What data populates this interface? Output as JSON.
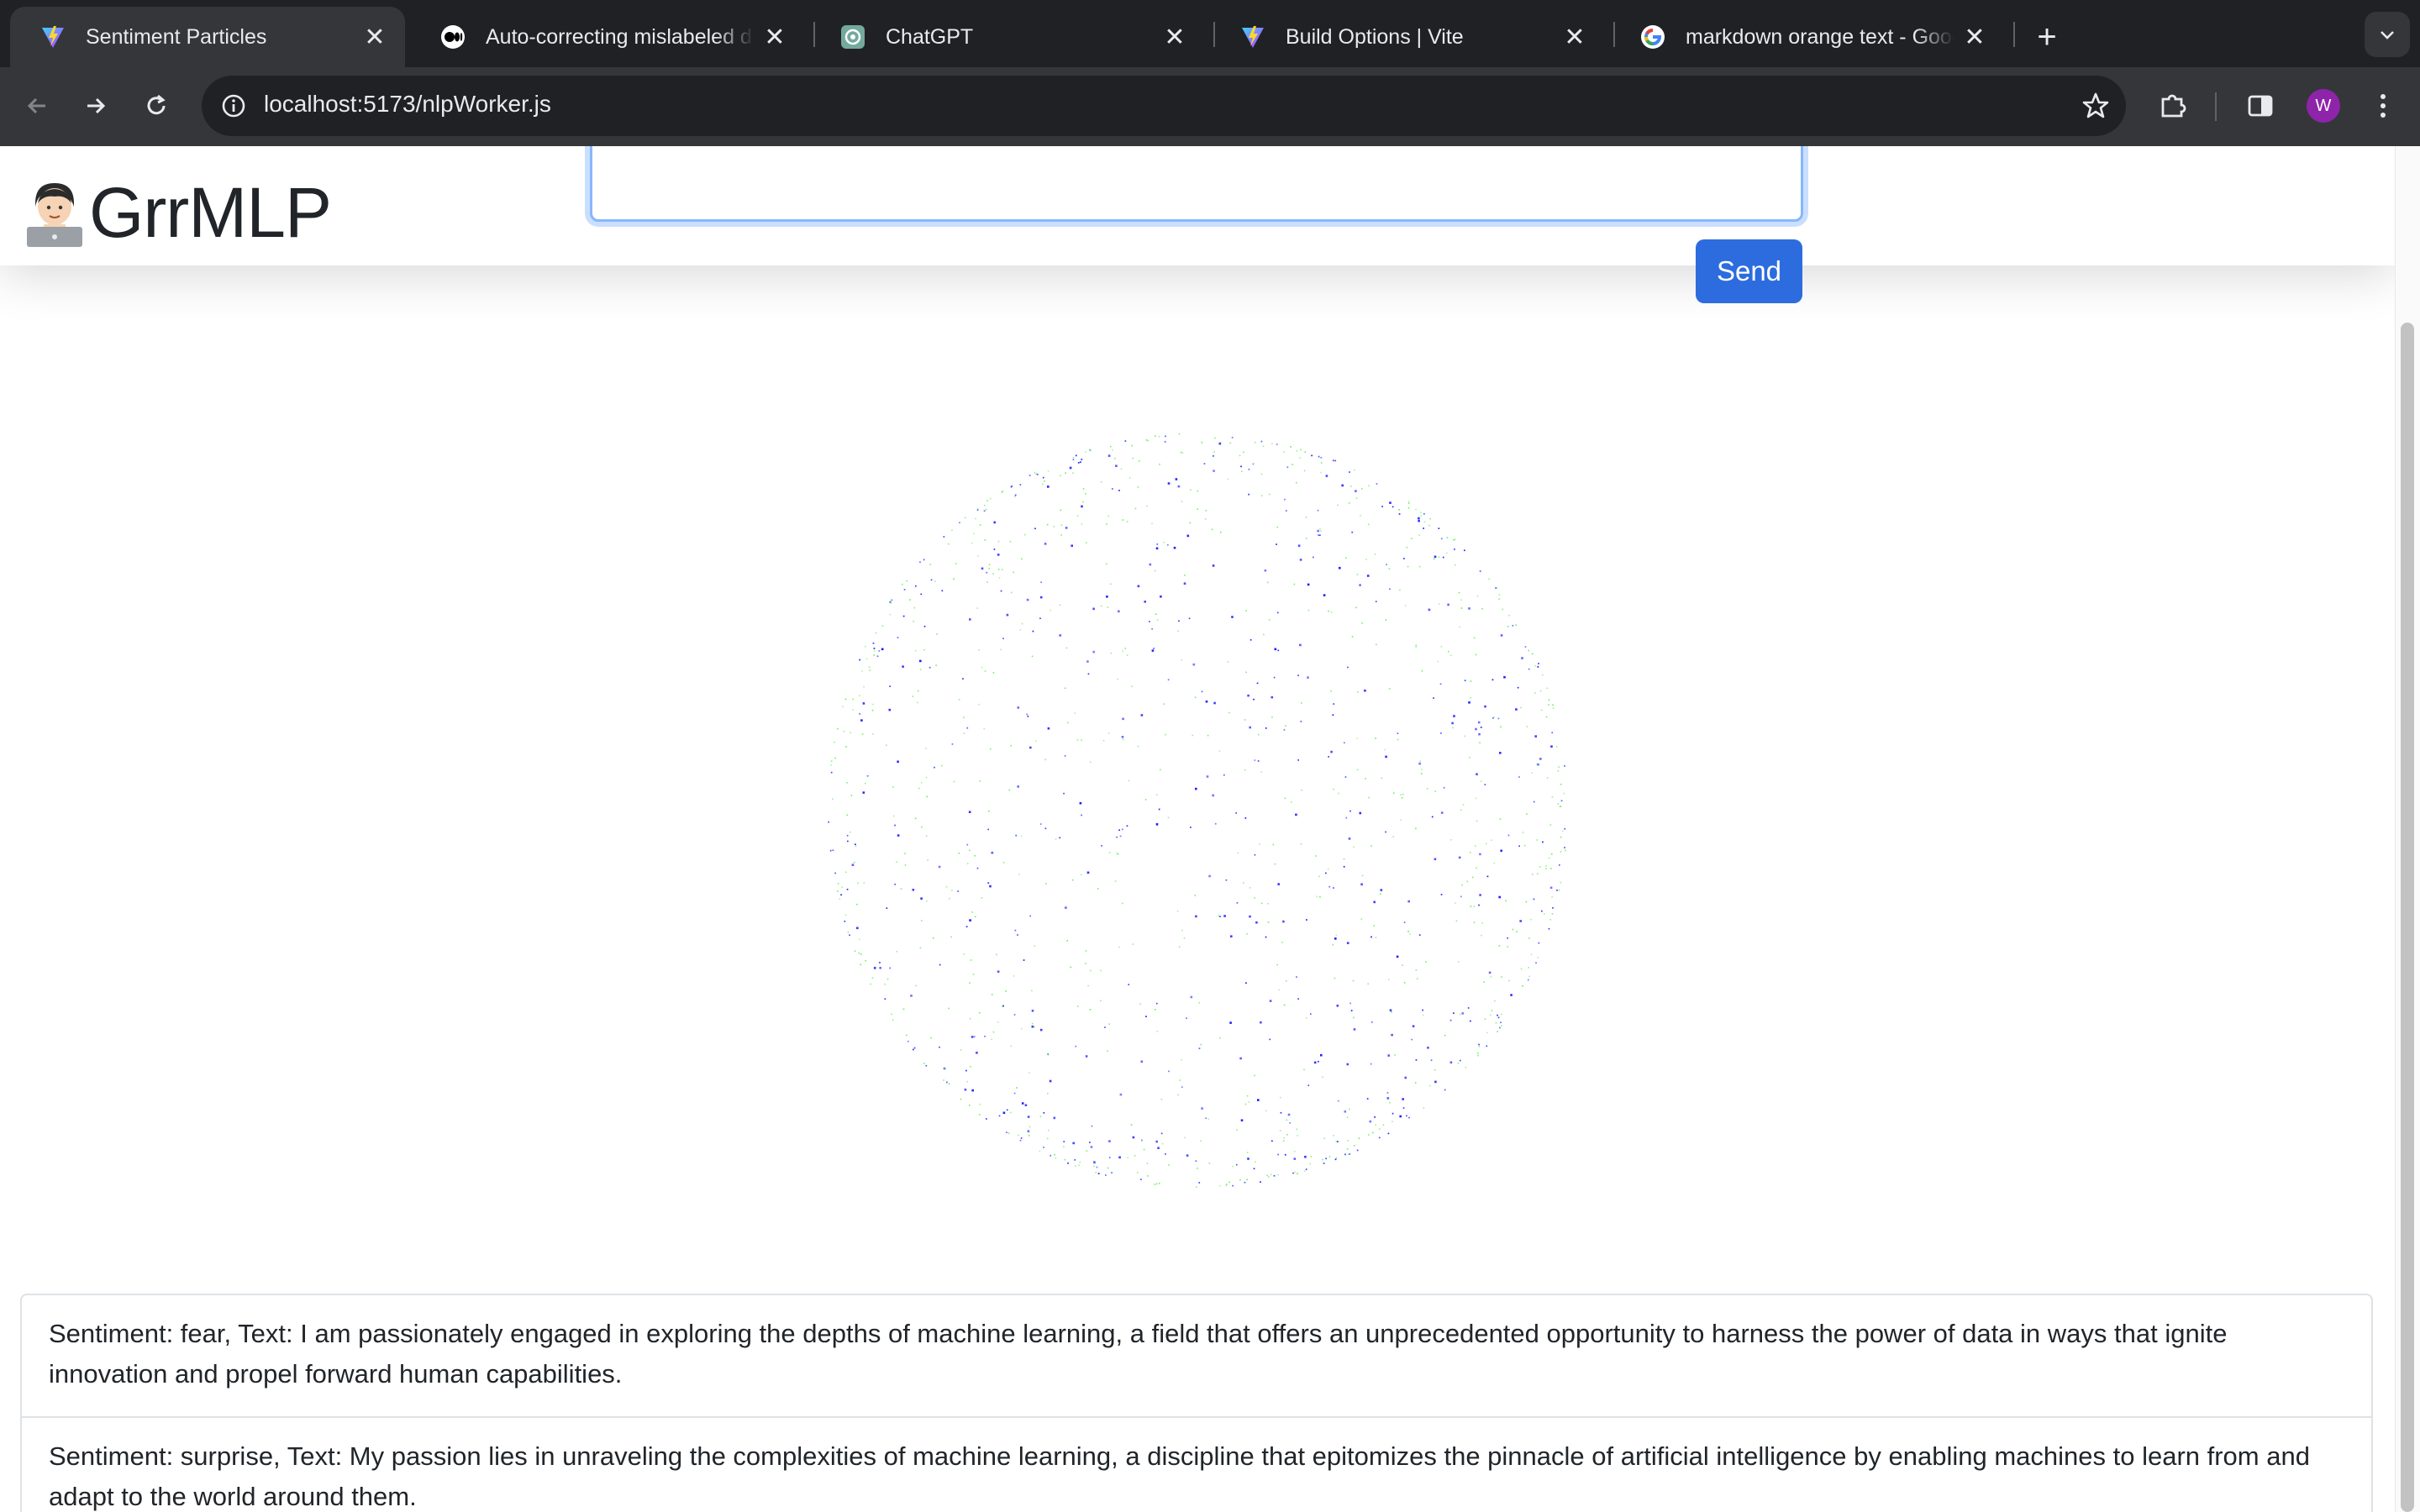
{
  "browser": {
    "tabs": [
      {
        "title": "Sentiment Particles",
        "icon": "vite-icon",
        "active": true
      },
      {
        "title": "Auto-correcting mislabeled d",
        "icon": "medium-icon",
        "active": false
      },
      {
        "title": "ChatGPT",
        "icon": "chatgpt-icon",
        "active": false
      },
      {
        "title": "Build Options | Vite",
        "icon": "vite-icon",
        "active": false
      },
      {
        "title": "markdown orange text - Goog",
        "icon": "google-icon",
        "active": false
      }
    ],
    "url": "localhost:5173/nlpWorker.js",
    "profile_initial": "W"
  },
  "app": {
    "brand_emoji": "technologist-emoji",
    "brand_name": "GrrMLP",
    "input_value": "",
    "send_label": "Send"
  },
  "particles": {
    "colors": {
      "blue": "#1a1aff",
      "green": "#66ee55"
    },
    "shape": "sphere"
  },
  "results": [
    {
      "text": "Sentiment: fear, Text: I am passionately engaged in exploring the depths of machine learning, a field that offers an unprecedented opportunity to harness the power of data in ways that ignite innovation and propel forward human capabilities."
    },
    {
      "text": "Sentiment: surprise, Text: My passion lies in unraveling the complexities of machine learning, a discipline that epitomizes the pinnacle of artificial intelligence by enabling machines to learn from and adapt to the world around them."
    }
  ],
  "colors": {
    "accent": "#2d6cdf",
    "chrome_dark": "#202124",
    "chrome_toolbar": "#35363a"
  }
}
